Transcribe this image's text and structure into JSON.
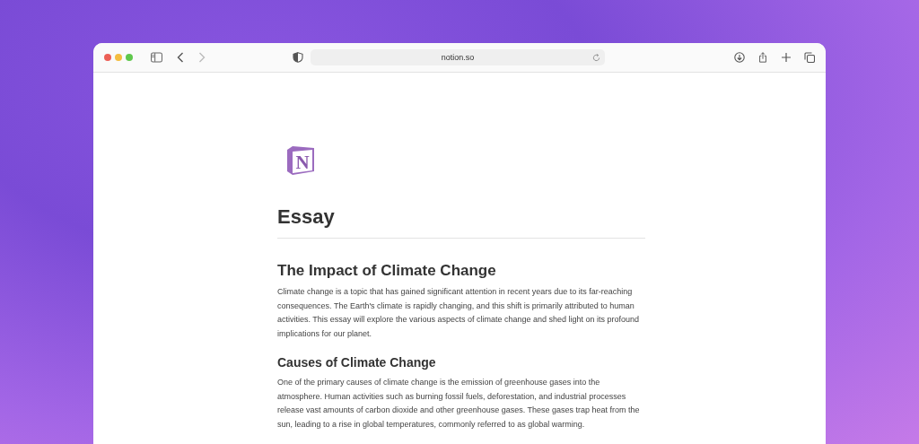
{
  "browser": {
    "address": "notion.so"
  },
  "page": {
    "logo_letter": "N",
    "title": "Essay",
    "sections": [
      {
        "kind": "h2",
        "text": "The Impact of Climate Change"
      },
      {
        "kind": "p",
        "text": "Climate change is a topic that has gained significant attention in recent years due to its far-reaching consequences. The Earth's climate is rapidly changing, and this shift is primarily attributed to human activities. This essay will explore the various aspects of climate change and shed light on its profound implications for our planet."
      },
      {
        "kind": "h3",
        "text": "Causes of Climate Change"
      },
      {
        "kind": "p",
        "text": "One of the primary causes of climate change is the emission of greenhouse gases into the atmosphere. Human activities such as burning fossil fuels, deforestation, and industrial processes release vast amounts of carbon dioxide and other greenhouse gases. These gases trap heat from the sun, leading to a rise in global temperatures, commonly referred to as global warming."
      }
    ]
  }
}
